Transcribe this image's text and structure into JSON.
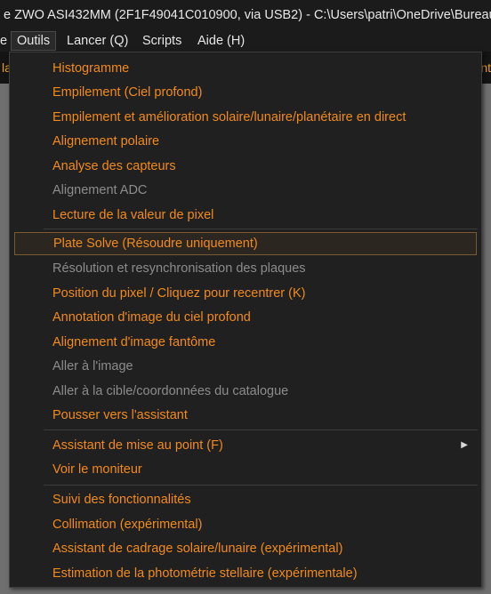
{
  "window": {
    "title": "e  ZWO ASI432MM (2F1F49041C010900, via USB2) - C:\\Users\\patri\\OneDrive\\Bureau\\S"
  },
  "menubar": {
    "items": [
      {
        "label": "e"
      },
      {
        "label": "Outils"
      },
      {
        "label": "Lancer (Q)"
      },
      {
        "label": "Scripts"
      },
      {
        "label": "Aide (H)"
      }
    ]
  },
  "toolbar": {
    "left_edge": "la",
    "right_edge": "nt"
  },
  "colors": {
    "enabled_text": "#f28a1c",
    "disabled_text": "#8c8c8c",
    "menu_bg": "#202020",
    "highlight_border": "#7a5a30"
  },
  "dropdown": {
    "items": [
      {
        "label": "Histogramme",
        "enabled": true
      },
      {
        "label": "Empilement (Ciel profond)",
        "enabled": true
      },
      {
        "label": "Empilement et amélioration solaire/lunaire/planétaire en direct",
        "enabled": true
      },
      {
        "label": "Alignement polaire",
        "enabled": true
      },
      {
        "label": "Analyse des capteurs",
        "enabled": true
      },
      {
        "label": "Alignement ADC",
        "enabled": false
      },
      {
        "label": "Lecture de la valeur de pixel",
        "enabled": true
      },
      {
        "label": "Plate Solve (Résoudre uniquement)",
        "enabled": true,
        "highlighted": true
      },
      {
        "label": "Résolution et resynchronisation des plaques",
        "enabled": false
      },
      {
        "label": "Position du pixel / Cliquez pour recentrer (K)",
        "enabled": true
      },
      {
        "label": "Annotation d'image du ciel profond",
        "enabled": true
      },
      {
        "label": "Alignement d'image fantôme",
        "enabled": true
      },
      {
        "label": "Aller à l'image",
        "enabled": false
      },
      {
        "label": "Aller à la cible/coordonnées du catalogue",
        "enabled": false
      },
      {
        "label": "Pousser vers l'assistant",
        "enabled": true
      },
      {
        "label": "Assistant de mise au point (F)",
        "enabled": true,
        "submenu": true
      },
      {
        "label": "Voir le moniteur",
        "enabled": true
      },
      {
        "label": "Suivi des fonctionnalités",
        "enabled": true
      },
      {
        "label": "Collimation (expérimental)",
        "enabled": true
      },
      {
        "label": "Assistant de cadrage solaire/lunaire (expérimental)",
        "enabled": true
      },
      {
        "label": "Estimation de la photométrie stellaire (expérimentale)",
        "enabled": true
      }
    ],
    "submenu_icon": "chevron-right-icon"
  }
}
